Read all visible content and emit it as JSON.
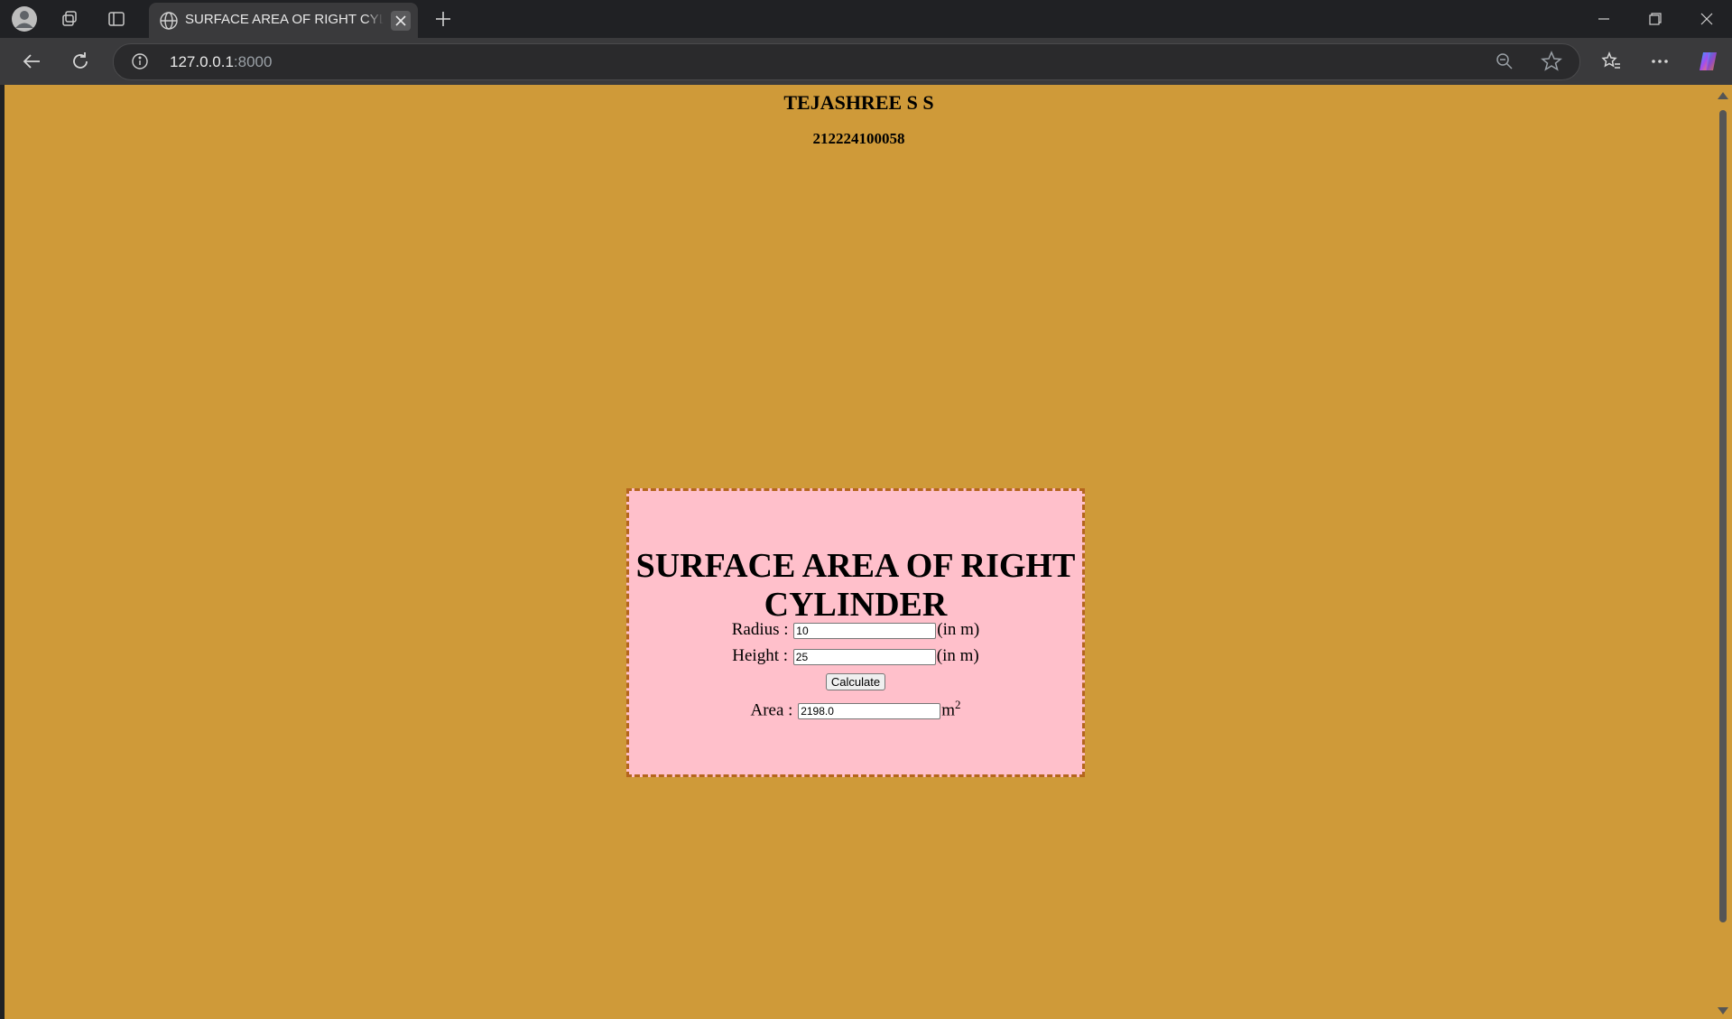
{
  "browser": {
    "tab_title": "SURFACE AREA OF RIGHT CYLINDER",
    "url_host": "127.0.0.1",
    "url_port": ":8000"
  },
  "page": {
    "name": "TEJASHREE S S",
    "register_number": "212224100058",
    "heading": "SURFACE AREA OF RIGHT CYLINDER",
    "radius_label": "Radius :",
    "radius_value": "10",
    "radius_unit": "(in m)",
    "height_label": "Height :",
    "height_value": "25",
    "height_unit": "(in m)",
    "calculate_label": "Calculate",
    "area_label": "Area :",
    "area_value": "2198.0",
    "area_unit": "m",
    "area_unit_exponent": "2"
  },
  "colors": {
    "page_background": "#cf9a39",
    "card_background": "#ffc0cb",
    "card_border": "#b5651d"
  }
}
